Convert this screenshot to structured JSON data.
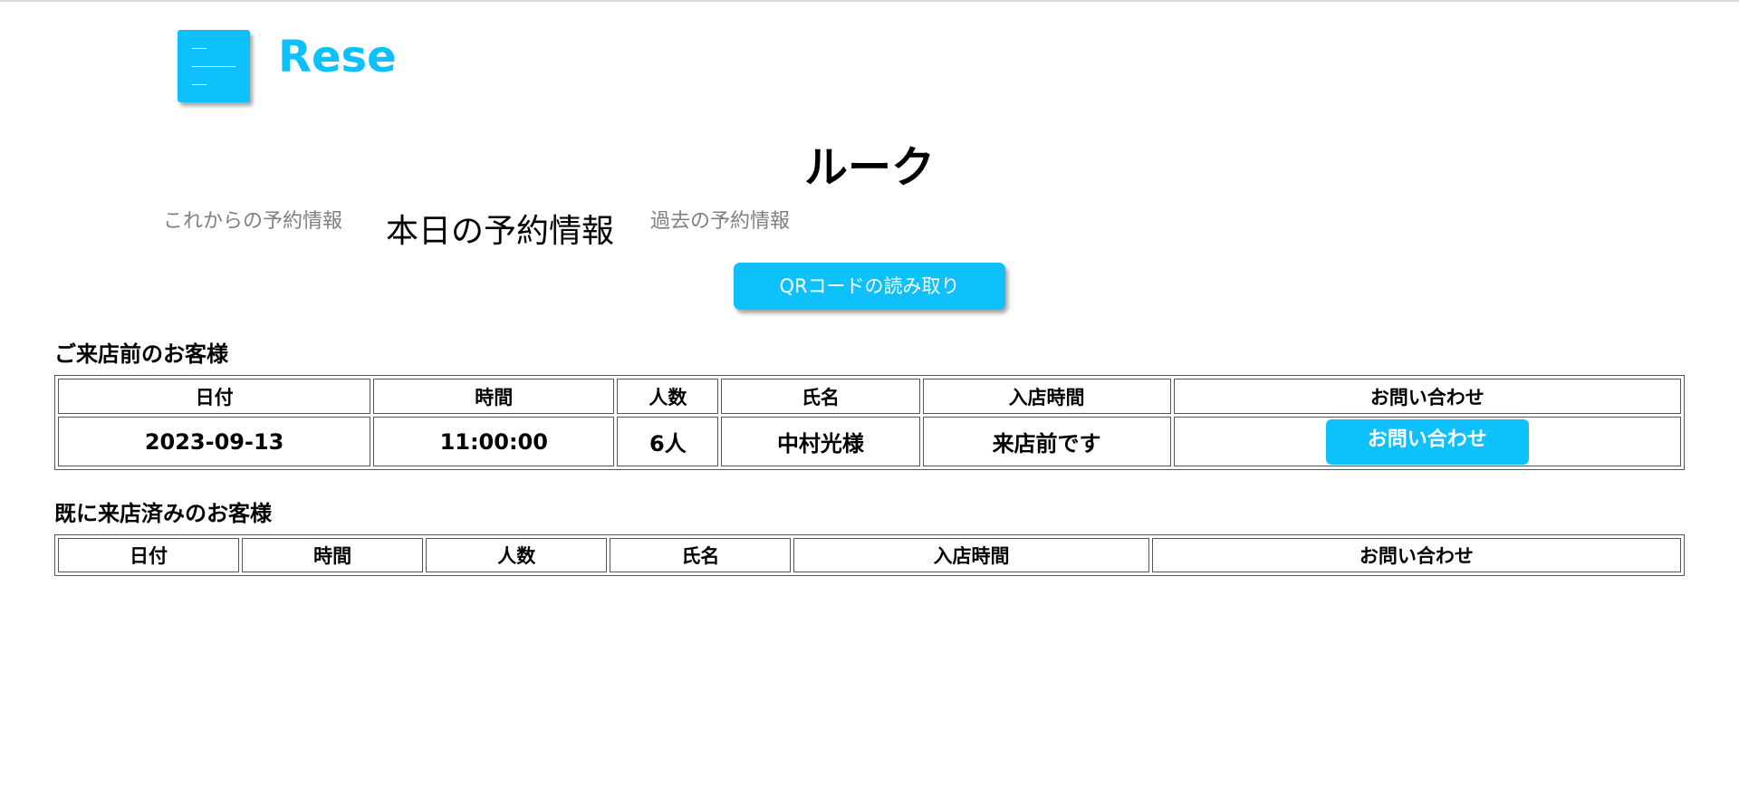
{
  "header": {
    "logo": "Rese",
    "menu_icon": "hamburger-menu-icon"
  },
  "shop": {
    "name": "ルーク"
  },
  "tabs": [
    {
      "label": "これからの予約情報",
      "active": false
    },
    {
      "label": "本日の予約情報",
      "active": true
    },
    {
      "label": "過去の予約情報",
      "active": false
    }
  ],
  "qr_button": {
    "label": "QRコードの読み取り"
  },
  "colors": {
    "accent": "#0ec0fb",
    "inactive_tab": "#808080"
  },
  "before_visit": {
    "title": "ご来店前のお客様",
    "headers": [
      "日付",
      "時間",
      "人数",
      "氏名",
      "入店時間",
      "お問い合わせ"
    ],
    "rows": [
      {
        "date": "2023-09-13",
        "time": "11:00:00",
        "people": "6人",
        "name": "中村光様",
        "entry_time": "来店前です",
        "contact_label": "お問い合わせ"
      }
    ]
  },
  "visited": {
    "title": "既に来店済みのお客様",
    "headers": [
      "日付",
      "時間",
      "人数",
      "氏名",
      "入店時間",
      "お問い合わせ"
    ],
    "rows": []
  }
}
